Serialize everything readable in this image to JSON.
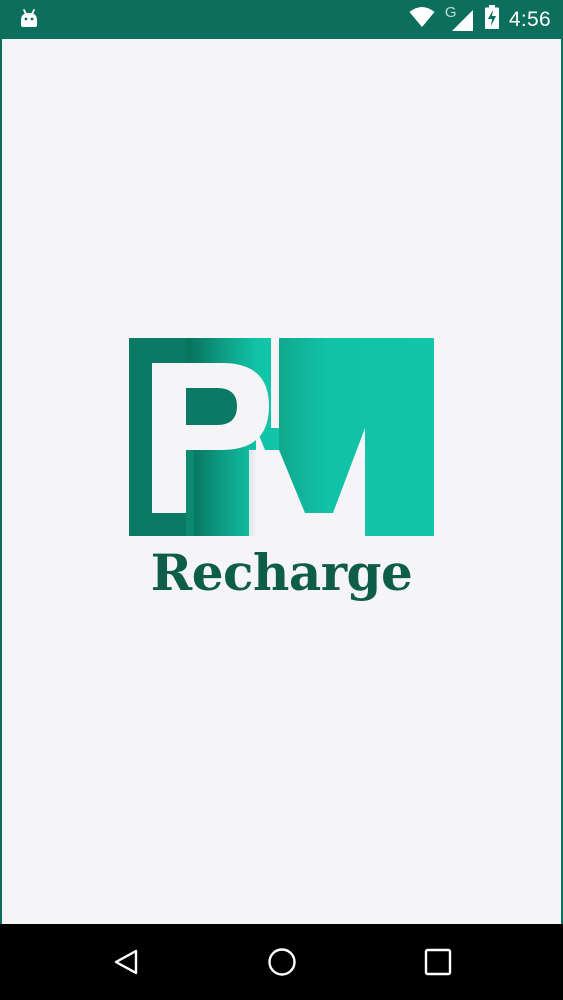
{
  "status_bar": {
    "time": "4:56",
    "network_letter": "G",
    "icons": [
      "android-icon",
      "wifi-icon",
      "signal-icon",
      "battery-charging-icon"
    ],
    "background_color": "#0c6f5b"
  },
  "splash": {
    "logo_letters": "PM",
    "logo_text": "Recharge",
    "logo_colors": {
      "dark": "#0b7a64",
      "light": "#12c4a8",
      "text": "#0d5d48"
    },
    "background_color": "#f5f4f7"
  },
  "nav_bar": {
    "buttons": [
      "back-icon",
      "home-icon",
      "recents-icon"
    ]
  }
}
